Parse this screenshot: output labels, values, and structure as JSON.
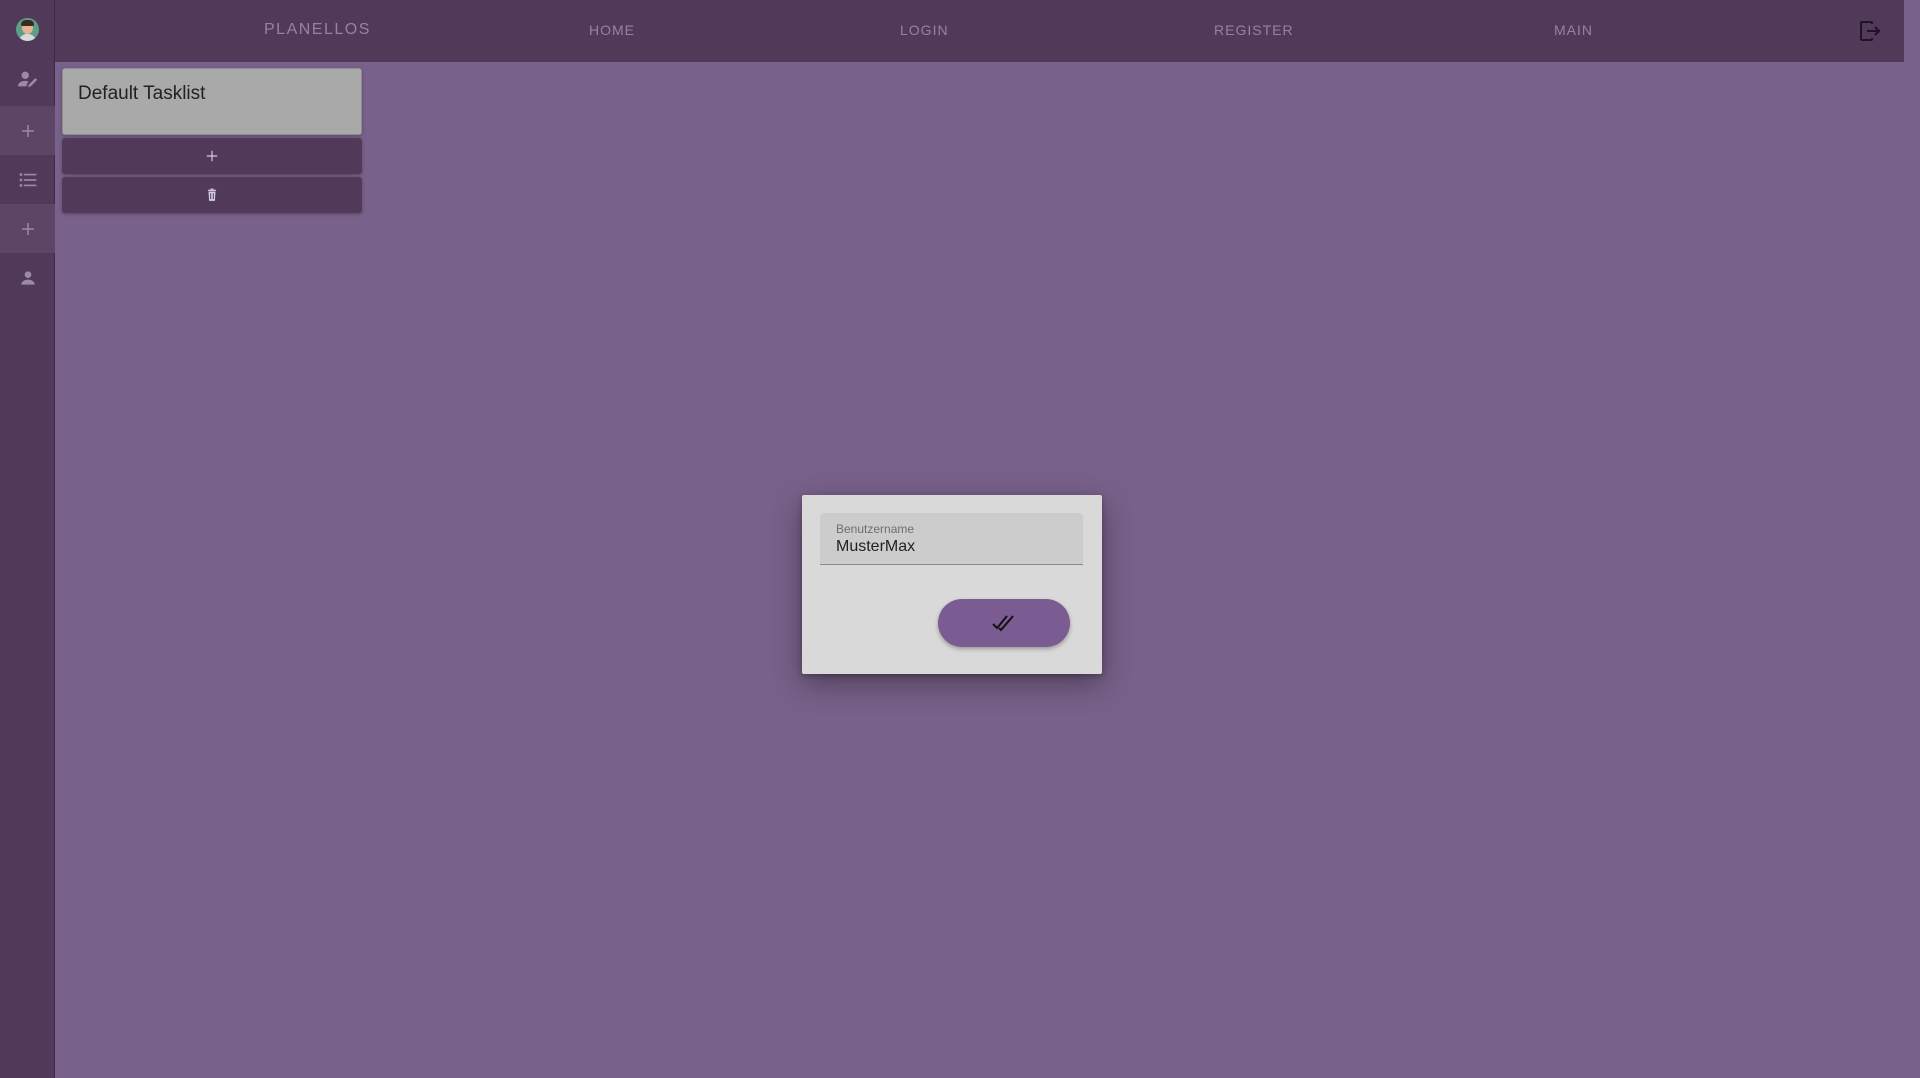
{
  "sidebar": {
    "items": [
      {
        "name": "assign",
        "icon": "person-edit-icon"
      },
      {
        "name": "add-task",
        "icon": "plus-icon"
      },
      {
        "name": "tasklists",
        "icon": "list-icon"
      },
      {
        "name": "add-tasklist",
        "icon": "plus-icon"
      },
      {
        "name": "profile",
        "icon": "person-icon"
      }
    ],
    "active_item": "add-task",
    "avatar_icon": "user-avatar"
  },
  "navbar": {
    "brand": "PLANELLOS",
    "links": [
      "HOME",
      "LOGIN",
      "REGISTER",
      "MAIN"
    ],
    "logout_icon": "logout-icon"
  },
  "tasklist": {
    "title": "Default Tasklist",
    "add_icon": "plus-icon",
    "delete_icon": "trash-icon"
  },
  "dialog": {
    "field_label": "Benutzername",
    "field_value": "MusterMax",
    "confirm_icon": "double-check-icon"
  },
  "colors": {
    "background": "#78618a",
    "bar": "#513959",
    "dialog": "#d9d9d9",
    "accent_button": "#7a5b92"
  }
}
